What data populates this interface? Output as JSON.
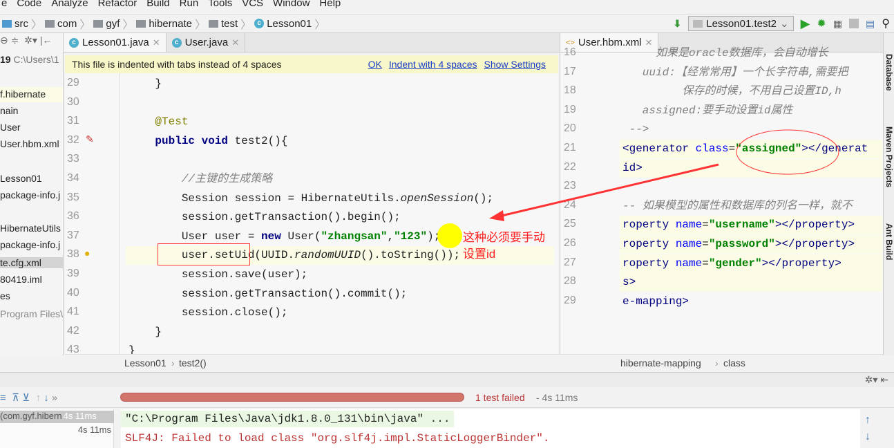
{
  "menu": [
    "e",
    "Code",
    "Analyze",
    "Refactor",
    "Build",
    "Run",
    "Tools",
    "VCS",
    "Window",
    "Help"
  ],
  "navbar": {
    "crumbs": [
      "src",
      "com",
      "gyf",
      "hibernate",
      "test",
      "Lesson01"
    ]
  },
  "run": {
    "config": "Lesson01.test2"
  },
  "project": {
    "header_num": "19",
    "header_path": "C:\\Users\\1",
    "items": [
      "f.hibernate",
      "nain",
      "User",
      "User.hbm.xml",
      "Lesson01",
      "package-info.j",
      "HibernateUtils",
      "package-info.j",
      "te.cfg.xml",
      "80419.iml",
      "es",
      "Program Files\\"
    ]
  },
  "tabs": [
    {
      "label": "Lesson01.java"
    },
    {
      "label": "User.java"
    }
  ],
  "notice": {
    "text": "This file is indented with tabs instead of 4 spaces",
    "ok": "OK",
    "indent": "Indent with 4 spaces",
    "settings": "Show Settings"
  },
  "editor": {
    "lines": [
      {
        "n": "29",
        "t": [
          [
            "    }",
            ""
          ]
        ]
      },
      {
        "n": "30",
        "t": []
      },
      {
        "n": "31",
        "t": [
          [
            "    ",
            ""
          ],
          [
            "@Test",
            "an"
          ]
        ]
      },
      {
        "n": "32",
        "t": [
          [
            "    ",
            ""
          ],
          [
            "public void ",
            "kw"
          ],
          [
            "test2(){",
            ""
          ]
        ]
      },
      {
        "n": "33",
        "t": []
      },
      {
        "n": "34",
        "t": [
          [
            "        ",
            ""
          ],
          [
            "//主键的生成策略",
            "cm"
          ]
        ]
      },
      {
        "n": "35",
        "t": [
          [
            "        Session session = HibernateUtils.",
            ""
          ],
          [
            "openSession",
            "it"
          ],
          [
            "();",
            ""
          ]
        ]
      },
      {
        "n": "36",
        "t": [
          [
            "        session.getTransaction().begin();",
            ""
          ]
        ]
      },
      {
        "n": "37",
        "t": [
          [
            "        User user = ",
            ""
          ],
          [
            "new ",
            "kw"
          ],
          [
            "User(",
            ""
          ],
          [
            "\"zhangsan\"",
            "str"
          ],
          [
            ",",
            ""
          ],
          [
            "\"123\"",
            "str"
          ],
          [
            ");",
            ""
          ]
        ]
      },
      {
        "n": "38",
        "t": [
          [
            "        user.setUid(UUID.",
            ""
          ],
          [
            "randomUUID",
            "it"
          ],
          [
            "().toString());",
            ""
          ]
        ],
        "hl": true
      },
      {
        "n": "39",
        "t": [
          [
            "        session.save(user);",
            ""
          ]
        ]
      },
      {
        "n": "40",
        "t": [
          [
            "        session.getTransaction().commit();",
            ""
          ]
        ]
      },
      {
        "n": "41",
        "t": [
          [
            "        session.close();",
            ""
          ]
        ]
      },
      {
        "n": "42",
        "t": [
          [
            "    }",
            ""
          ]
        ]
      },
      {
        "n": "43",
        "t": [
          [
            "}",
            ""
          ]
        ]
      }
    ],
    "breadcrumb": [
      "Lesson01",
      "test2()"
    ]
  },
  "right": {
    "tab": "User.hbm.xml",
    "lines": [
      {
        "n": "16",
        "t": [
          [
            "     如果是oracle数据库，会自动增长",
            "cm"
          ]
        ]
      },
      {
        "n": "17",
        "t": [
          [
            "   uuid:【经常常用】一个长字符串,需要把",
            "cm"
          ]
        ]
      },
      {
        "n": "18",
        "t": [
          [
            "         保存的时候，不用自己设置ID,h",
            "cm"
          ]
        ]
      },
      {
        "n": "19",
        "t": [
          [
            "   assigned:要手动设置id属性",
            "cm"
          ]
        ]
      },
      {
        "n": "20",
        "t": [
          [
            " -->",
            "cm"
          ]
        ]
      },
      {
        "n": "21",
        "t": [
          [
            "<generator ",
            "tag"
          ],
          [
            "class",
            "attr"
          ],
          [
            "=",
            ""
          ],
          [
            "\"assigned\"",
            "str"
          ],
          [
            "></",
            "tag"
          ],
          [
            "generat",
            "tag"
          ]
        ],
        "hl": true
      },
      {
        "n": "22",
        "t": [
          [
            "id>",
            "tag"
          ]
        ],
        "hl": true
      },
      {
        "n": "23",
        "t": []
      },
      {
        "n": "24",
        "t": [
          [
            "-- 如果模型的属性和数据库的列名一样，就不",
            "cm"
          ]
        ]
      },
      {
        "n": "25",
        "t": [
          [
            "roperty ",
            "tag"
          ],
          [
            "name",
            "attr"
          ],
          [
            "=",
            ""
          ],
          [
            "\"username\"",
            "str"
          ],
          [
            "></property>",
            "tag"
          ]
        ],
        "hl": true
      },
      {
        "n": "26",
        "t": [
          [
            "roperty ",
            "tag"
          ],
          [
            "name",
            "attr"
          ],
          [
            "=",
            ""
          ],
          [
            "\"password\"",
            "str"
          ],
          [
            "></property>",
            "tag"
          ]
        ],
        "hl": true
      },
      {
        "n": "27",
        "t": [
          [
            "roperty ",
            "tag"
          ],
          [
            "name",
            "attr"
          ],
          [
            "=",
            ""
          ],
          [
            "\"gender\"",
            "str"
          ],
          [
            "></property>",
            "tag"
          ]
        ],
        "hl": true
      },
      {
        "n": "28",
        "t": [
          [
            "s>",
            "tag"
          ]
        ],
        "hl": true
      },
      {
        "n": "29",
        "t": [
          [
            "e-mapping>",
            "tag"
          ]
        ]
      }
    ],
    "breadcrumb": [
      "hibernate-mapping",
      "class"
    ]
  },
  "tools": [
    "Database",
    "Maven Projects",
    "Ant Build"
  ],
  "tests": {
    "status": "1 test failed",
    "time": " - 4s 11ms",
    "progress": 100,
    "tree": [
      {
        "label": "(com.gyf.hibern",
        "time": "4s 11ms"
      },
      {
        "label": "",
        "time": "4s 11ms"
      }
    ]
  },
  "console": [
    "\"C:\\Program Files\\Java\\jdk1.8.0_131\\bin\\java\" ...",
    "SLF4J: Failed to load class \"org.slf4j.impl.StaticLoggerBinder\"."
  ],
  "annotation": {
    "text1": "这种必须要手动",
    "text2": "设置id",
    "color": "#ff2020"
  }
}
